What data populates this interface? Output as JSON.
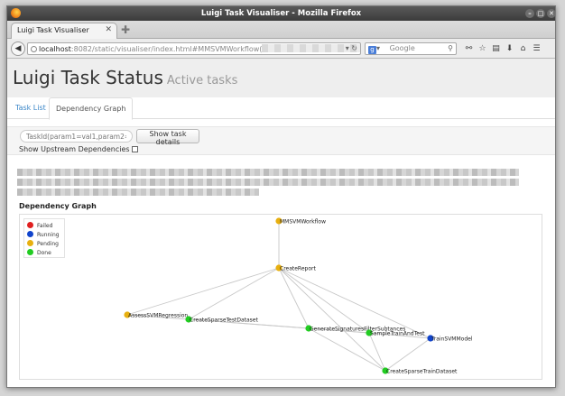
{
  "window": {
    "title": "Luigi Task Visualiser - Mozilla Firefox"
  },
  "browser": {
    "tab_title": "Luigi Task Visualiser",
    "url_host": "localhost",
    "url_path": ":8082/static/visualiser/index.html#MMSVMWorkflow(",
    "search_placeholder": "Google"
  },
  "page": {
    "title": "Luigi Task Status",
    "subtitle": "Active tasks",
    "tabs": [
      "Task List",
      "Dependency Graph"
    ],
    "task_input_placeholder": "TaskId(param1=val1,param2=va",
    "show_button": "Show task details",
    "upstream_label": "Show Upstream Dependencies",
    "section_title": "Dependency Graph"
  },
  "colors": {
    "failed": "#e02020",
    "running": "#1144cc",
    "pending": "#e8b010",
    "done": "#22cc22",
    "link": "#3a86c8"
  },
  "legend": [
    {
      "label": "Failed",
      "status": "failed"
    },
    {
      "label": "Running",
      "status": "running"
    },
    {
      "label": "Pending",
      "status": "pending"
    },
    {
      "label": "Done",
      "status": "done"
    }
  ],
  "graph": {
    "nodes": [
      {
        "id": "MMSVMWorkflow",
        "label": "MMSVMWorkflow",
        "status": "pending"
      },
      {
        "id": "CreateReport",
        "label": "CreateReport",
        "status": "pending"
      },
      {
        "id": "AssessSVMRegression",
        "label": "AssessSVMRegression",
        "status": "pending"
      },
      {
        "id": "CreateSparseTestDataset",
        "label": "CreateSparseTestDataset",
        "status": "done"
      },
      {
        "id": "GenerateSignaturesFilterSubtances",
        "label": "GenerateSignaturesFilterSubtances",
        "status": "done"
      },
      {
        "id": "SampleTrainAndTest",
        "label": "SampleTrainAndTest",
        "status": "done"
      },
      {
        "id": "TrainSVMModel",
        "label": "TrainSVMModel",
        "status": "running"
      },
      {
        "id": "CreateSparseTrainDataset",
        "label": "CreateSparseTrainDataset",
        "status": "done"
      }
    ],
    "edges": [
      [
        "MMSVMWorkflow",
        "CreateReport"
      ],
      [
        "CreateReport",
        "AssessSVMRegression"
      ],
      [
        "CreateReport",
        "CreateSparseTestDataset"
      ],
      [
        "CreateReport",
        "GenerateSignaturesFilterSubtances"
      ],
      [
        "CreateReport",
        "SampleTrainAndTest"
      ],
      [
        "CreateReport",
        "TrainSVMModel"
      ],
      [
        "CreateReport",
        "CreateSparseTrainDataset"
      ],
      [
        "AssessSVMRegression",
        "CreateSparseTestDataset"
      ],
      [
        "CreateSparseTestDataset",
        "GenerateSignaturesFilterSubtances"
      ],
      [
        "CreateSparseTestDataset",
        "SampleTrainAndTest"
      ],
      [
        "GenerateSignaturesFilterSubtances",
        "SampleTrainAndTest"
      ],
      [
        "GenerateSignaturesFilterSubtances",
        "CreateSparseTrainDataset"
      ],
      [
        "SampleTrainAndTest",
        "TrainSVMModel"
      ],
      [
        "SampleTrainAndTest",
        "CreateSparseTrainDataset"
      ],
      [
        "TrainSVMModel",
        "CreateSparseTrainDataset"
      ]
    ]
  }
}
